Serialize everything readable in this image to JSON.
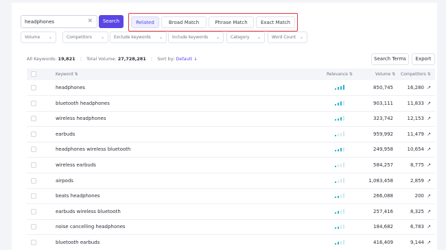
{
  "search": {
    "value": "headphones",
    "button_label": "Search"
  },
  "match_tabs": [
    {
      "label": "Related",
      "active": true
    },
    {
      "label": "Broad Match",
      "active": false
    },
    {
      "label": "Phrase Match",
      "active": false
    },
    {
      "label": "Exact Match",
      "active": false
    }
  ],
  "filters": [
    {
      "label": "Volume"
    },
    {
      "label": "Competitors"
    },
    {
      "label": "Exclude keywords"
    },
    {
      "label": "Include keywords"
    },
    {
      "label": "Category"
    },
    {
      "label": "Word Count"
    }
  ],
  "summary": {
    "all_keywords_label": "All Keywords:",
    "all_keywords_value": "19,821",
    "total_volume_label": "Total Volume:",
    "total_volume_value": "27,728,281",
    "sort_label": "Sort by:",
    "sort_value": "Default"
  },
  "toolbar": {
    "search_terms_label": "Search Terms",
    "export_label": "Export"
  },
  "table": {
    "headers": {
      "keyword": "Keyword",
      "relevance": "Relevance",
      "volume": "Volume",
      "competitors": "Competitors"
    },
    "rows": [
      {
        "keyword": "headphones",
        "relevance": 4,
        "volume": "850,745",
        "competitors": "16,280"
      },
      {
        "keyword": "bluetooth headphones",
        "relevance": 3,
        "volume": "903,111",
        "competitors": "11,833"
      },
      {
        "keyword": "wireless headphones",
        "relevance": 3,
        "volume": "323,742",
        "competitors": "12,153"
      },
      {
        "keyword": "earbuds",
        "relevance": 1,
        "volume": "959,992",
        "competitors": "11,479"
      },
      {
        "keyword": "headphones wireless bluetooth",
        "relevance": 3,
        "volume": "249,958",
        "competitors": "10,654"
      },
      {
        "keyword": "wireless earbuds",
        "relevance": 1,
        "volume": "584,257",
        "competitors": "8,775"
      },
      {
        "keyword": "airpods",
        "relevance": 1,
        "volume": "1,083,458",
        "competitors": "2,859"
      },
      {
        "keyword": "beats headphones",
        "relevance": 2,
        "volume": "266,088",
        "competitors": "200"
      },
      {
        "keyword": "earbuds wireless bluetooth",
        "relevance": 2,
        "volume": "257,416",
        "competitors": "8,325"
      },
      {
        "keyword": "noise cancelling headphones",
        "relevance": 2,
        "volume": "184,682",
        "competitors": "6,783"
      },
      {
        "keyword": "bluetooth earbuds",
        "relevance": 2,
        "volume": "416,409",
        "competitors": "9,144"
      }
    ]
  },
  "colors": {
    "accent": "#5b46e4",
    "highlight_border": "#e0323a",
    "relevance_on": "#1fb5d0",
    "relevance_off": "#cfe9f1"
  },
  "icons": {
    "clear": "close-icon",
    "sort": "sort-icon",
    "dropdown": "chevron-down-icon",
    "trend": "external-arrow-icon"
  }
}
